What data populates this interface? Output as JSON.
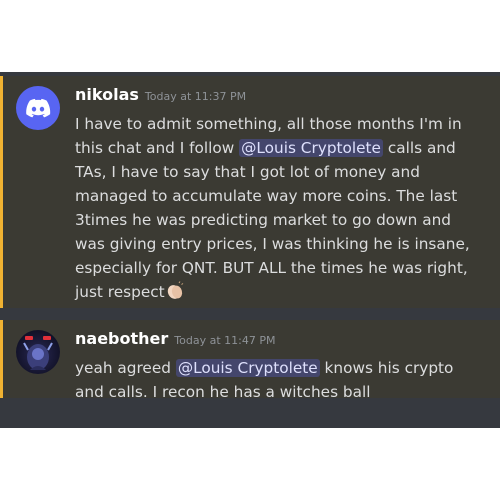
{
  "messages": [
    {
      "username": "nikolas",
      "timestamp": "Today at 11:37 PM",
      "avatar_icon": "discord-logo-icon",
      "text_before_mention": "I have to admit something, all those months I'm in this chat and I follow ",
      "mention": "@Louis Cryptolete",
      "text_after_mention": " calls and TAs, I have to say that I got lot of money and managed to accumulate way more coins. The last 3times he was predicting market to go down and was giving entry prices, I was thinking he is insane, especially for QNT. BUT ALL the times he was right, just respect",
      "emoji": "clapping-hands-icon"
    },
    {
      "username": "naebother",
      "timestamp": "Today at 11:47 PM",
      "avatar_icon": "user-avatar-image",
      "text_before_mention": "yeah agreed ",
      "mention": "@Louis Cryptolete",
      "text_after_mention": " knows his crypto and calls. I recon he has a witches ball"
    }
  ],
  "colors": {
    "background": "#36393f",
    "highlight": "#3b3a33",
    "highlight_bar": "#f0b232",
    "mention_bg": "#5865f2",
    "username": "#ffffff",
    "text": "#dcddde",
    "timestamp": "#8e9297"
  }
}
